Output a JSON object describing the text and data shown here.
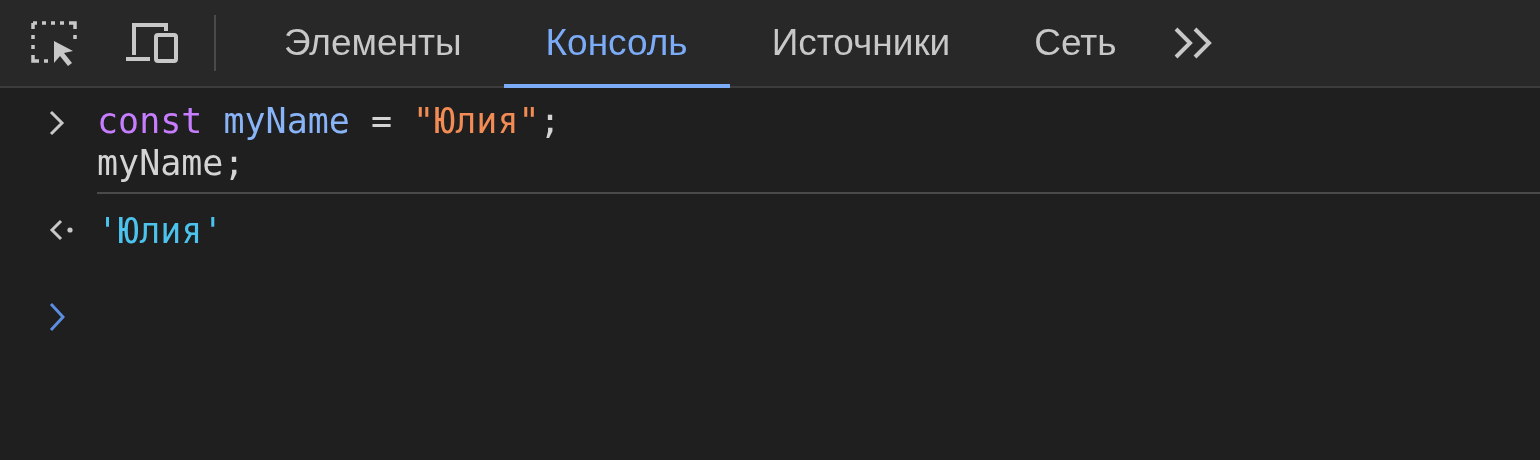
{
  "toolbar": {
    "tabs": [
      {
        "label": "Элементы",
        "selected": false
      },
      {
        "label": "Консоль",
        "selected": true
      },
      {
        "label": "Источники",
        "selected": false
      },
      {
        "label": "Сеть",
        "selected": false
      }
    ]
  },
  "console": {
    "entries": [
      {
        "kind": "input",
        "lines": [
          [
            {
              "kind": "keyword",
              "text": "const "
            },
            {
              "kind": "variable",
              "text": "myName"
            },
            {
              "kind": "plain",
              "text": " = "
            },
            {
              "kind": "string",
              "text": "\"Юлия\""
            },
            {
              "kind": "plain",
              "text": ";"
            }
          ],
          [
            {
              "kind": "plain",
              "text": "myName;"
            }
          ]
        ]
      },
      {
        "kind": "output",
        "lines": [
          [
            {
              "kind": "result",
              "text": "'Юлия'"
            }
          ]
        ]
      },
      {
        "kind": "prompt"
      }
    ]
  }
}
